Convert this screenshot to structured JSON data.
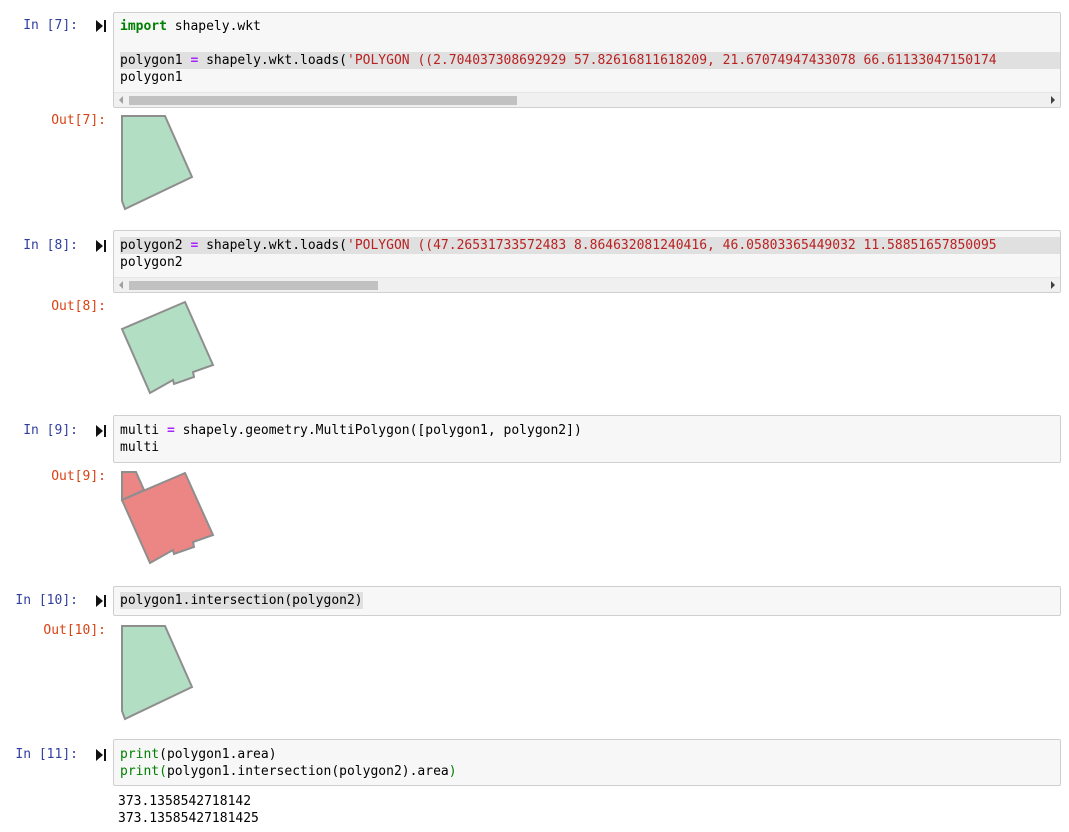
{
  "cells": [
    {
      "in_prompt": "In [7]:",
      "out_prompt": "Out[7]:",
      "line1_kw": "import",
      "line1_rest": " shapely.wkt",
      "line3_var": "polygon1 ",
      "line3_op": "=",
      "line3_mid": " shapely.wkt.loads(",
      "line3_str": "'POLYGON ((2.704037308692929 57.82616811618209, 21.67074947433078 66.61133047150174",
      "line4": "polygon1"
    },
    {
      "in_prompt": "In [8]:",
      "out_prompt": "Out[8]:",
      "line1_var": "polygon2 ",
      "line1_op": "=",
      "line1_mid": " shapely.wkt.loads(",
      "line1_str": "'POLYGON ((47.26531733572483 8.864632081240416, 46.05803365449032 11.58851657850095",
      "line2": "polygon2"
    },
    {
      "in_prompt": "In [9]:",
      "out_prompt": "Out[9]:",
      "line1_var": "multi ",
      "line1_op": "=",
      "line1_rest": " shapely.geometry.MultiPolygon([polygon1, polygon2])",
      "line2": "multi"
    },
    {
      "in_prompt": "In [10]:",
      "out_prompt": "Out[10]:",
      "line1": "polygon1.intersection(polygon2)"
    },
    {
      "in_prompt": "In [11]:",
      "line1_fn": "print",
      "line1_rest": "(polygon1.area)",
      "line2_fn": "print",
      "line2_paren_open": "(",
      "line2_rest": "polygon1.intersection(polygon2).area",
      "line2_paren_close": ")",
      "output_line1": "373.1358542718142",
      "output_line2": "373.13585427181425"
    }
  ],
  "colors": {
    "shape_green_fill": "#b2dfc3",
    "shape_red_fill": "#ec8684",
    "shape_stroke": "#8e8e8e",
    "in_prompt": "#303f9f",
    "out_prompt": "#d84315"
  }
}
